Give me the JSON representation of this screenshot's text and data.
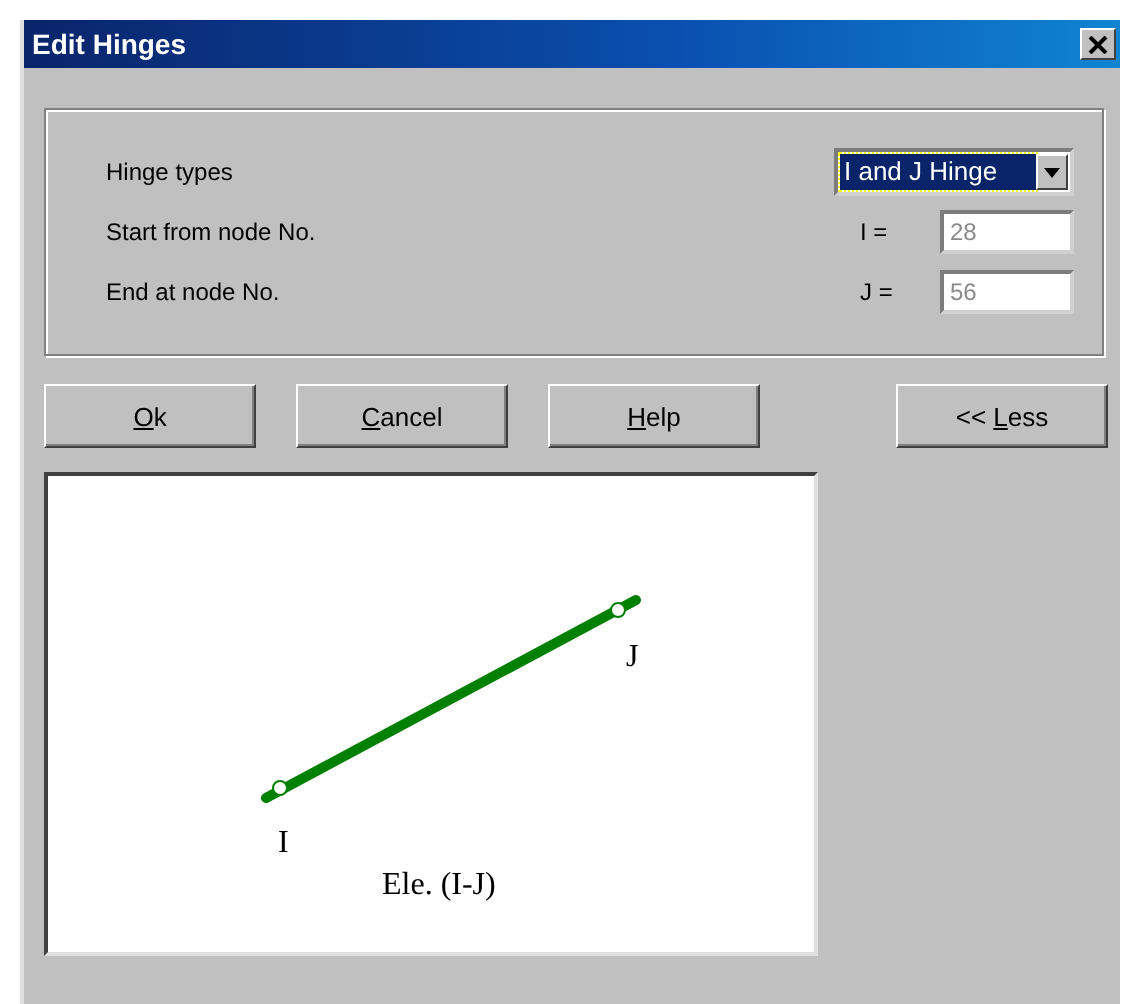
{
  "window": {
    "title": "Edit Hinges"
  },
  "form": {
    "hinge_types": {
      "label": "Hinge types",
      "value": "I and J Hinge",
      "focused": true
    },
    "start": {
      "label": "Start from node No.",
      "symbol": "I =",
      "value": "28",
      "disabled": true
    },
    "end": {
      "label": "End at node No.",
      "symbol": "J =",
      "value": "56",
      "disabled": true
    }
  },
  "buttons": [
    {
      "key": "O",
      "after": "k",
      "kind": "action"
    },
    {
      "key": "C",
      "after": "ancel",
      "kind": "action"
    },
    {
      "key": "H",
      "after": "elp",
      "kind": "action"
    },
    {
      "before": "<< ",
      "key": "L",
      "after": "ess",
      "kind": "toggle"
    }
  ],
  "preview": {
    "start_label": "I",
    "end_label": "J",
    "caption": "Ele. (I-J)",
    "hinge_i": true,
    "hinge_j": true
  }
}
